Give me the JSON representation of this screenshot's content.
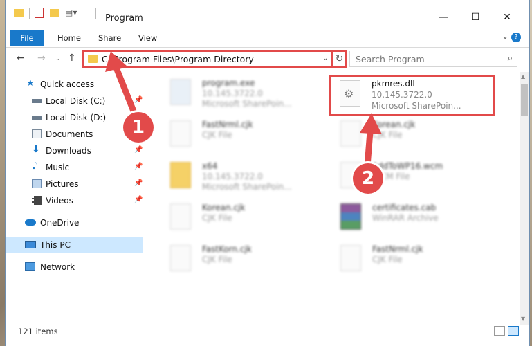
{
  "titlebar": {
    "title": "Program",
    "minimize": "—",
    "maximize": "☐",
    "close": "✕"
  },
  "ribbon": {
    "tabs": [
      "File",
      "Home",
      "Share",
      "View"
    ],
    "help": "?"
  },
  "address": {
    "path": "C:\\Program Files\\Program Directory",
    "dropdown": "⌄",
    "refresh": "↻"
  },
  "search": {
    "placeholder": "Search Program"
  },
  "sidebar": {
    "items": [
      {
        "label": "Quick access",
        "icon": "star-icon",
        "pinned": false
      },
      {
        "label": "Local Disk (C:)",
        "icon": "drive-icon",
        "pinned": true
      },
      {
        "label": "Local Disk (D:)",
        "icon": "drive-icon",
        "pinned": false
      },
      {
        "label": "Documents",
        "icon": "documents-icon",
        "pinned": false
      },
      {
        "label": "Downloads",
        "icon": "download-icon",
        "pinned": true
      },
      {
        "label": "Music",
        "icon": "music-icon",
        "pinned": true
      },
      {
        "label": "Pictures",
        "icon": "pictures-icon",
        "pinned": true
      },
      {
        "label": "Videos",
        "icon": "videos-icon",
        "pinned": true
      },
      {
        "label": "OneDrive",
        "icon": "onedrive-icon",
        "pinned": false
      },
      {
        "label": "This PC",
        "icon": "pc-icon",
        "pinned": false,
        "selected": true
      },
      {
        "label": "Network",
        "icon": "network-icon",
        "pinned": false
      }
    ]
  },
  "files": [
    {
      "name": "program.exe",
      "line2": "10.145.3722.0",
      "line3": "Microsoft SharePoin...",
      "icon": "exe-icon"
    },
    {
      "name": "pkmres.dll",
      "line2": "10.145.3722.0",
      "line3": "Microsoft SharePoin...",
      "icon": "dll-gear-icon",
      "highlighted": true
    },
    {
      "name": "FastNrml.cjk",
      "line2": "CJK File",
      "line3": "",
      "icon": "file-icon"
    },
    {
      "name": "Korean.cjk",
      "line2": "CJK File",
      "line3": "",
      "icon": "file-icon"
    },
    {
      "name": "x64",
      "line2": "10.145.3722.0",
      "line3": "Microsoft SharePoin...",
      "icon": "folder-icon"
    },
    {
      "name": "AddToWP16.wcm",
      "line2": "WCM File",
      "line3": "",
      "icon": "file-icon"
    },
    {
      "name": "Korean.cjk",
      "line2": "CJK File",
      "line3": "",
      "icon": "file-icon"
    },
    {
      "name": "certificates.cab",
      "line2": "WinRAR Archive",
      "line3": "",
      "icon": "archive-icon"
    },
    {
      "name": "FastKorn.cjk",
      "line2": "CJK File",
      "line3": "",
      "icon": "file-icon"
    },
    {
      "name": "FastNrml.cjk",
      "line2": "CJK File",
      "line3": "",
      "icon": "file-icon"
    }
  ],
  "status": {
    "count": "121 items"
  },
  "callouts": [
    "1",
    "2"
  ],
  "colors": {
    "accent": "#1979ca",
    "highlight": "#e24a4a",
    "selected": "#cde8ff"
  }
}
